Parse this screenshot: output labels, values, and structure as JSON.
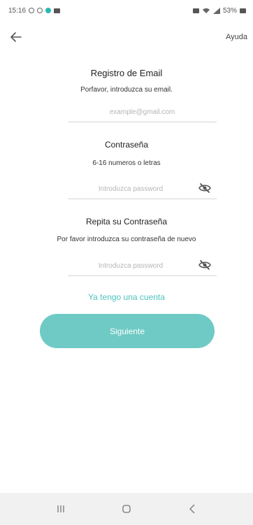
{
  "status_bar": {
    "time": "15:16",
    "right_text": "53%"
  },
  "top_bar": {
    "help_label": "Ayuda"
  },
  "form": {
    "title": "Registro de Email",
    "email_subtitle": "Porfavor, introduzca su email.",
    "email_placeholder": "example@gmail.com",
    "password_label": "Contraseña",
    "password_hint": "6-16 numeros o letras",
    "password_placeholder": "Introduzca password",
    "repeat_label": "Repita su Contraseña",
    "repeat_hint": "Por favor introduzca su contraseña de nuevo",
    "repeat_placeholder": "Introduzca password",
    "have_account": "Ya tengo una cuenta",
    "next_label": "Siguiente"
  },
  "colors": {
    "accent": "#4cc3bd",
    "button": "#6fcac5"
  }
}
